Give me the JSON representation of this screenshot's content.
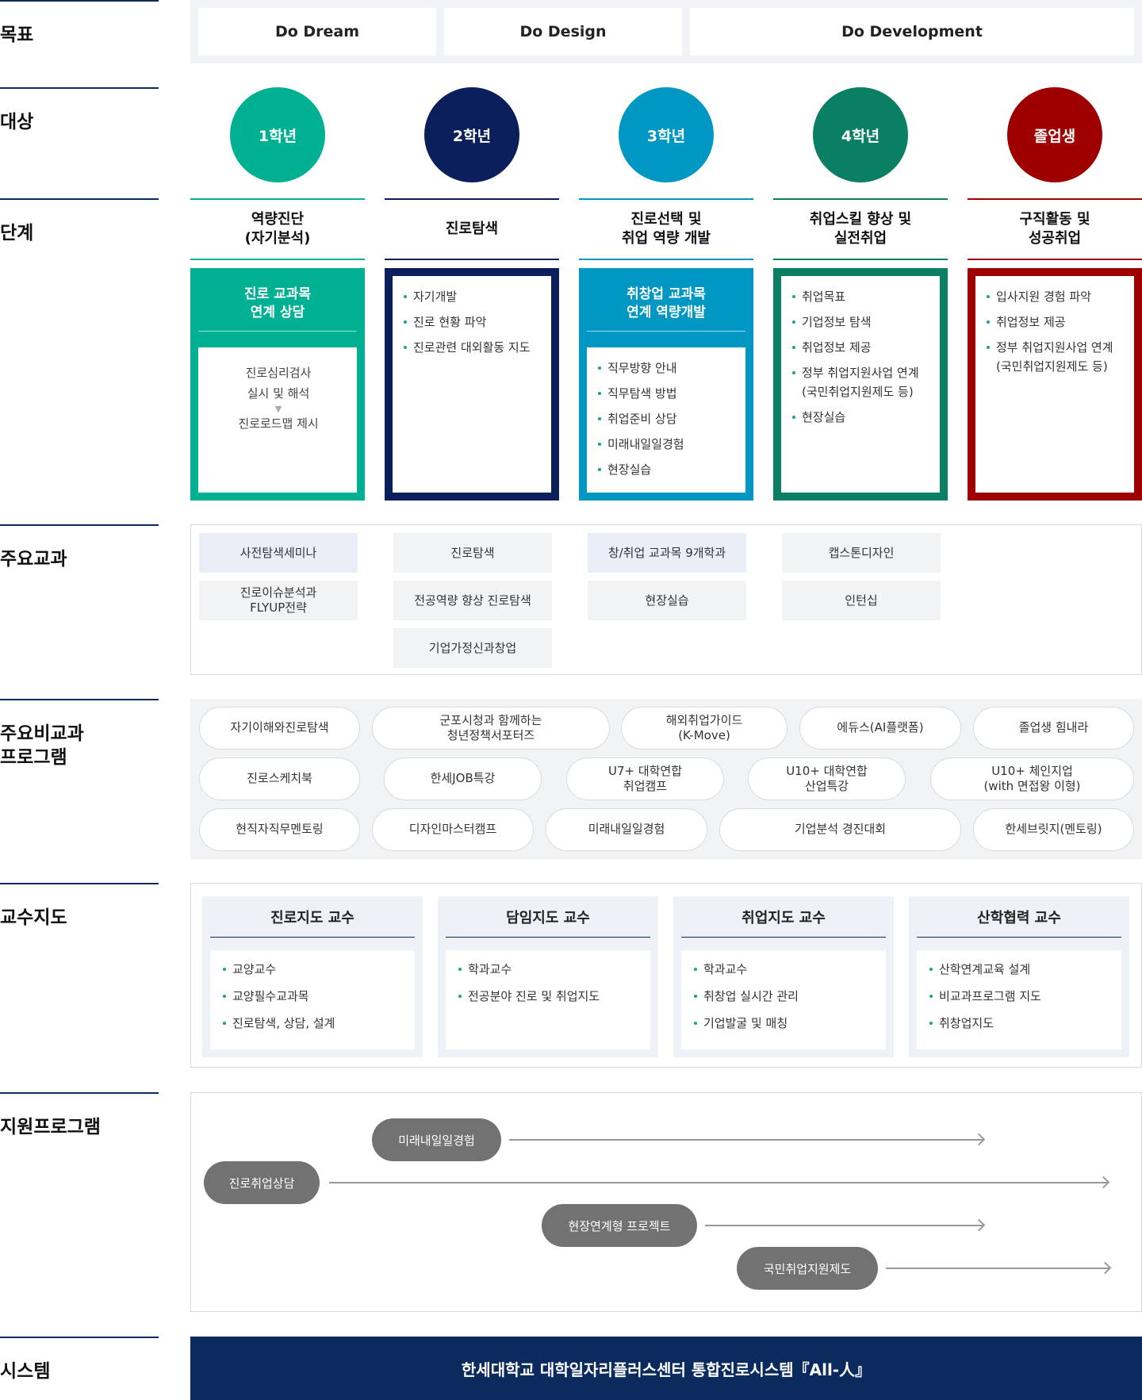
{
  "labels": {
    "goal": "목표",
    "target": "대상",
    "stage": "단계",
    "courses": "주요교과",
    "programs_line1": "주요비교과",
    "programs_line2": "프로그램",
    "professors": "교수지도",
    "support": "지원프로그램",
    "system": "시스템"
  },
  "goals": [
    "Do Dream",
    "Do Design",
    "Do Development"
  ],
  "targets": [
    {
      "label": "1학년",
      "color": "#00b093"
    },
    {
      "label": "2학년",
      "color": "#0a1f5c"
    },
    {
      "label": "3학년",
      "color": "#0098c2"
    },
    {
      "label": "4학년",
      "color": "#0b7f64"
    },
    {
      "label": "졸업생",
      "color": "#9e0000"
    }
  ],
  "stages": [
    {
      "line1": "역량진단",
      "line2": "(자기분석)"
    },
    {
      "line1": "진로탐색",
      "line2": ""
    },
    {
      "line1": "진로선택 및",
      "line2": "취업 역량 개발"
    },
    {
      "line1": "취업스킬 향상 및",
      "line2": "실전취업"
    },
    {
      "line1": "구직활동 및",
      "line2": "성공취업"
    }
  ],
  "details": {
    "d1": {
      "head1": "진로 교과목",
      "head2": "연계 상담",
      "line1": "진로심리검사",
      "line2": "실시 및 해석",
      "arrow": "▼",
      "line3": "진로로드맵 제시"
    },
    "d2": {
      "items": [
        "자기개발",
        "진로 현황 파악",
        "진로관련 대외활동 지도"
      ]
    },
    "d3": {
      "head1": "취창업 교과목",
      "head2": "연계 역량개발",
      "items": [
        "직무방향 안내",
        "직무탐색 방법",
        "취업준비 상담",
        "미래내일일경험",
        "현장실습"
      ]
    },
    "d4": {
      "items": [
        "취업목표",
        "기업정보 탐색",
        "취업정보 제공",
        "정부 취업지원사업 연계",
        "(국민취업지원제도 등)",
        "현장실습"
      ]
    },
    "d5": {
      "items": [
        "입사지원 경험 파악",
        "취업정보 제공",
        "정부 취업지원사업 연계",
        "(국민취업지원제도 등)"
      ]
    }
  },
  "courses": {
    "c1": [
      "사전탐색세미나",
      "진로이슈분석과",
      "FLYUP전략"
    ],
    "c2": [
      "진로탐색",
      "전공역량 향상 진로탐색",
      "기업가정신과창업"
    ],
    "c3": [
      "창/취업 교과목 9개학과",
      "현장실습"
    ],
    "c4": [
      "캡스톤디자인",
      "인턴십"
    ]
  },
  "programs": {
    "r1": [
      "자기이해와진로탐색",
      "군포시청과 함께하는",
      "청년정책서포터즈",
      "해외취업가이드",
      "(K-Move)",
      "에듀스(AI플랫폼)",
      "졸업생 힘내라"
    ],
    "r2": [
      "진로스케치북",
      "한세JOB특강",
      "U7+ 대학연합",
      "취업캠프",
      "U10+ 대학연합",
      "산업특강",
      "U10+ 체인지업",
      "(with 면접왕 이형)"
    ],
    "r3": [
      "현직자직무멘토링",
      "디자인마스터캠프",
      "미래내일일경험",
      "기업분석 경진대회",
      "한세브릿지(멘토링)"
    ]
  },
  "professors": [
    {
      "title": "진로지도 교수",
      "items": [
        "교양교수",
        "교양필수교과목",
        "진로탐색, 상담, 설계"
      ]
    },
    {
      "title": "담임지도 교수",
      "items": [
        "학과교수",
        "전공분야 진로 및 취업지도"
      ]
    },
    {
      "title": "취업지도 교수",
      "items": [
        "학과교수",
        "취창업 실시간 관리",
        "기업발굴 및 매칭"
      ]
    },
    {
      "title": "산학협력 교수",
      "items": [
        "산학연계교육 설계",
        "비교과프로그램 지도",
        "취창업지도"
      ]
    }
  ],
  "support": [
    "미래내일일경험",
    "진로취업상담",
    "현장연계형 프로젝트",
    "국민취업지원제도"
  ],
  "system": "한세대학교 대학일자리플러스센터 통합진로시스템『All-人』"
}
